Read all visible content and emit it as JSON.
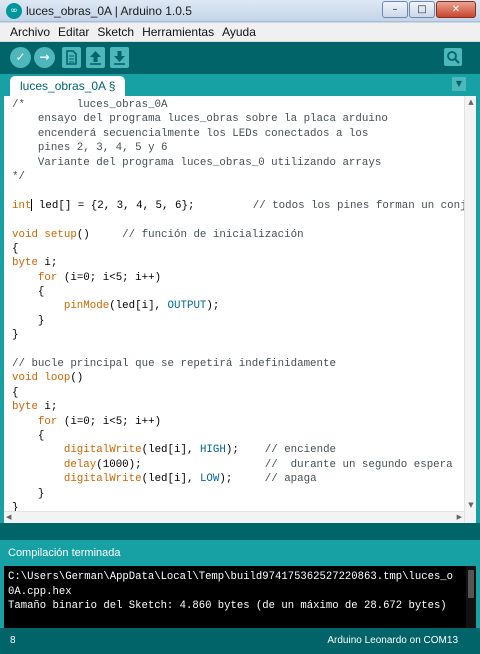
{
  "window": {
    "title": "luces_obras_0A | Arduino 1.0.5",
    "app_icon": "arduino-logo-icon",
    "buttons": {
      "minimize": "–",
      "maximize": "□",
      "close": "✕"
    }
  },
  "menu": [
    "Archivo",
    "Editar",
    "Sketch",
    "Herramientas",
    "Ayuda"
  ],
  "toolbar": {
    "verify": "✓",
    "upload": "→",
    "icons": [
      "check-icon",
      "right-arrow-icon",
      "new-document-icon",
      "open-up-arrow-icon",
      "save-down-arrow-icon",
      "magnifier-icon"
    ]
  },
  "tab": {
    "label": "luces_obras_0A §",
    "menu_arrow": "▼"
  },
  "colors": {
    "teal_dark": "#006468",
    "teal_mid": "#17a1a5",
    "button": "#4db7bb",
    "keyword": "#cc6600",
    "constant": "#006699",
    "comment": "#434f54"
  },
  "code": [
    [
      {
        "t": "/*        luces_obras_0A",
        "c": "com"
      }
    ],
    [
      {
        "t": "    ensayo del programa luces_obras sobre la placa arduino",
        "c": "com"
      }
    ],
    [
      {
        "t": "    encenderá secuencialmente los LEDs conectados a los",
        "c": "com"
      }
    ],
    [
      {
        "t": "    pines 2, 3, 4, 5 y 6",
        "c": "com"
      }
    ],
    [
      {
        "t": "    Variante del programa luces_obras_0 utilizando arrays",
        "c": "com"
      }
    ],
    [
      {
        "t": "*/",
        "c": "com"
      }
    ],
    [],
    [
      {
        "t": "int",
        "c": "kw"
      },
      {
        "t": " led[] = {2, 3, 4, 5, 6};         ",
        "c": "plain"
      },
      {
        "t": "// todos los pines forman un conjunto",
        "c": "com"
      }
    ],
    [],
    [
      {
        "t": "void",
        "c": "kw"
      },
      {
        "t": " ",
        "c": "plain"
      },
      {
        "t": "setup",
        "c": "fn"
      },
      {
        "t": "()     ",
        "c": "plain"
      },
      {
        "t": "// función de inicialización",
        "c": "com"
      }
    ],
    [
      {
        "t": "{",
        "c": "plain"
      }
    ],
    [
      {
        "t": "byte",
        "c": "kw"
      },
      {
        "t": " i;",
        "c": "plain"
      }
    ],
    [
      {
        "t": "    ",
        "c": "plain"
      },
      {
        "t": "for",
        "c": "kw"
      },
      {
        "t": " (i=0; i<5; i++)",
        "c": "plain"
      }
    ],
    [
      {
        "t": "    {",
        "c": "plain"
      }
    ],
    [
      {
        "t": "        ",
        "c": "plain"
      },
      {
        "t": "pinMode",
        "c": "fn"
      },
      {
        "t": "(led[i], ",
        "c": "plain"
      },
      {
        "t": "OUTPUT",
        "c": "const"
      },
      {
        "t": ");",
        "c": "plain"
      }
    ],
    [
      {
        "t": "    }",
        "c": "plain"
      }
    ],
    [
      {
        "t": "}",
        "c": "plain"
      }
    ],
    [],
    [
      {
        "t": "// bucle principal que se repetirá indefinidamente",
        "c": "com"
      }
    ],
    [
      {
        "t": "void",
        "c": "kw"
      },
      {
        "t": " ",
        "c": "plain"
      },
      {
        "t": "loop",
        "c": "fn"
      },
      {
        "t": "()",
        "c": "plain"
      }
    ],
    [
      {
        "t": "{",
        "c": "plain"
      }
    ],
    [
      {
        "t": "byte",
        "c": "kw"
      },
      {
        "t": " i;",
        "c": "plain"
      }
    ],
    [
      {
        "t": "    ",
        "c": "plain"
      },
      {
        "t": "for",
        "c": "kw"
      },
      {
        "t": " (i=0; i<5; i++)",
        "c": "plain"
      }
    ],
    [
      {
        "t": "    {",
        "c": "plain"
      }
    ],
    [
      {
        "t": "        ",
        "c": "plain"
      },
      {
        "t": "digitalWrite",
        "c": "fn"
      },
      {
        "t": "(led[i], ",
        "c": "plain"
      },
      {
        "t": "HIGH",
        "c": "const"
      },
      {
        "t": ");    ",
        "c": "plain"
      },
      {
        "t": "// enciende",
        "c": "com"
      }
    ],
    [
      {
        "t": "        ",
        "c": "plain"
      },
      {
        "t": "delay",
        "c": "fn"
      },
      {
        "t": "(1000);                   ",
        "c": "plain"
      },
      {
        "t": "//  durante un segundo espera",
        "c": "com"
      }
    ],
    [
      {
        "t": "        ",
        "c": "plain"
      },
      {
        "t": "digitalWrite",
        "c": "fn"
      },
      {
        "t": "(led[i], ",
        "c": "plain"
      },
      {
        "t": "LOW",
        "c": "const"
      },
      {
        "t": ");     ",
        "c": "plain"
      },
      {
        "t": "// apaga",
        "c": "com"
      }
    ],
    [
      {
        "t": "    }",
        "c": "plain"
      }
    ],
    [
      {
        "t": "}",
        "c": "plain"
      }
    ]
  ],
  "status": "Compilación terminada",
  "console": [
    "C:\\Users\\German\\AppData\\Local\\Temp\\build974175362527220863.tmp\\luces_obras_",
    "0A.cpp.hex",
    "Tamaño binario del Sketch: 4.860 bytes (de un máximo de 28.672 bytes)"
  ],
  "footer": {
    "line": "8",
    "board": "Arduino Leonardo on COM13"
  }
}
